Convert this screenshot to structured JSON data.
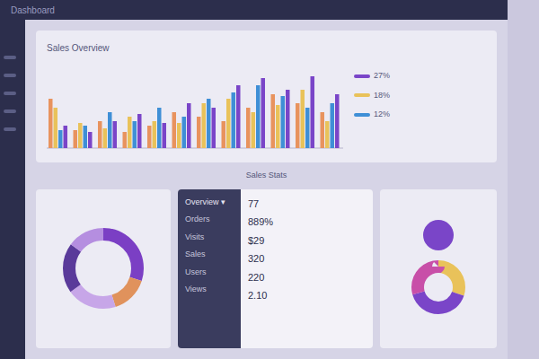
{
  "header": {
    "title": "Dashboard"
  },
  "bar_chart": {
    "title": "Sales Overview",
    "series": [
      {
        "color": "#e8935e",
        "values": [
          55,
          20,
          30,
          18,
          25,
          40,
          35,
          30,
          45,
          60,
          50,
          40
        ]
      },
      {
        "color": "#e9c25a",
        "values": [
          45,
          28,
          22,
          35,
          30,
          28,
          50,
          55,
          40,
          48,
          65,
          30
        ]
      },
      {
        "color": "#3f8fd6",
        "values": [
          20,
          25,
          40,
          30,
          45,
          35,
          55,
          62,
          70,
          58,
          45,
          50
        ]
      },
      {
        "color": "#7a45c8",
        "values": [
          25,
          18,
          30,
          38,
          28,
          50,
          45,
          70,
          78,
          65,
          80,
          60
        ]
      }
    ]
  },
  "section_label": "Sales Stats",
  "donut_left": {
    "segments": [
      {
        "value": 30,
        "color": "#7b3fc4"
      },
      {
        "value": 15,
        "color": "#e0925c"
      },
      {
        "value": 20,
        "color": "#c7a6e8"
      },
      {
        "value": 20,
        "color": "#5a3a9a"
      },
      {
        "value": 15,
        "color": "#b58ee0"
      }
    ]
  },
  "stats": {
    "menu": "Overview ▾",
    "header": "77",
    "rows": [
      {
        "label": "Orders",
        "value": "889%"
      },
      {
        "label": "Visits",
        "value": "$29"
      },
      {
        "label": "Sales",
        "value": "320"
      },
      {
        "label": "Users",
        "value": "220"
      },
      {
        "label": "Views",
        "value": "2.10"
      }
    ]
  },
  "legend": [
    {
      "color": "#7a45c8",
      "value": "27%"
    },
    {
      "color": "#e9c25a",
      "value": "18%"
    },
    {
      "color": "#3f8fd6",
      "value": "12%"
    }
  ],
  "donut_right": {
    "segments": [
      {
        "value": 30,
        "color": "#e9c25a"
      },
      {
        "value": 40,
        "color": "#7a45c8"
      },
      {
        "value": 30,
        "color": "#c84fa8"
      }
    ]
  }
}
